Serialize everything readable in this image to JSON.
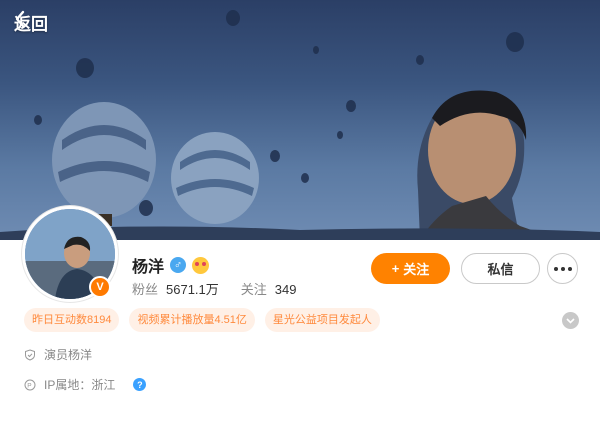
{
  "header": {
    "back_label": "返回"
  },
  "profile": {
    "name": "杨洋",
    "followers_label": "粉丝",
    "followers_value": "5671.1万",
    "following_label": "关注",
    "following_value": "349",
    "verified_badge": "V"
  },
  "actions": {
    "follow_label": "关注",
    "follow_plus": "+",
    "message_label": "私信"
  },
  "tags": [
    {
      "label": "昨日互动数8194"
    },
    {
      "label": "视频累计播放量4.51亿"
    },
    {
      "label": "星光公益项目发起人"
    }
  ],
  "info": {
    "identity": "演员杨洋",
    "ip_location": "IP属地：浙江",
    "help_symbol": "?"
  },
  "colors": {
    "accent": "#ff8200",
    "tag_bg": "#fff0e6",
    "tag_text": "#ff8a3d",
    "link_blue": "#3aa1ff"
  },
  "icons": [
    "chevron-left-icon",
    "male-icon",
    "emoji-icon",
    "more-icon",
    "chevron-down-icon",
    "shield-icon",
    "location-icon",
    "help-icon"
  ]
}
